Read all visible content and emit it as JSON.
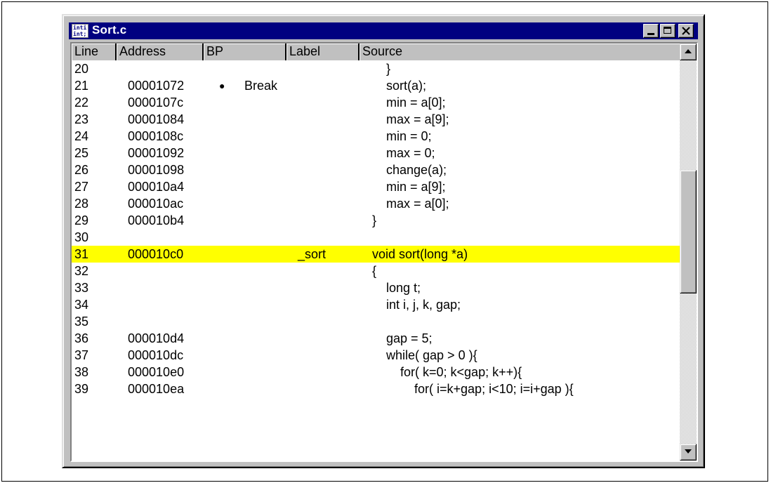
{
  "window": {
    "title": "Sort.c",
    "icon_text": [
      "inti",
      "int;"
    ],
    "controls": [
      "minimize",
      "maximize",
      "close"
    ]
  },
  "columns": {
    "line": "Line",
    "address": "Address",
    "bp": "BP",
    "label": "Label",
    "source": "Source"
  },
  "rows": [
    {
      "line": "20",
      "address": "",
      "bp_dot": "",
      "bp": "",
      "label": "",
      "source": "    }",
      "highlight": false
    },
    {
      "line": "21",
      "address": "00001072",
      "bp_dot": "●",
      "bp": "Break",
      "label": "",
      "source": "    sort(a);",
      "highlight": false
    },
    {
      "line": "22",
      "address": "0000107c",
      "bp_dot": "",
      "bp": "",
      "label": "",
      "source": "    min = a[0];",
      "highlight": false
    },
    {
      "line": "23",
      "address": "00001084",
      "bp_dot": "",
      "bp": "",
      "label": "",
      "source": "    max = a[9];",
      "highlight": false
    },
    {
      "line": "24",
      "address": "0000108c",
      "bp_dot": "",
      "bp": "",
      "label": "",
      "source": "    min = 0;",
      "highlight": false
    },
    {
      "line": "25",
      "address": "00001092",
      "bp_dot": "",
      "bp": "",
      "label": "",
      "source": "    max = 0;",
      "highlight": false
    },
    {
      "line": "26",
      "address": "00001098",
      "bp_dot": "",
      "bp": "",
      "label": "",
      "source": "    change(a);",
      "highlight": false
    },
    {
      "line": "27",
      "address": "000010a4",
      "bp_dot": "",
      "bp": "",
      "label": "",
      "source": "    min = a[9];",
      "highlight": false
    },
    {
      "line": "28",
      "address": "000010ac",
      "bp_dot": "",
      "bp": "",
      "label": "",
      "source": "    max = a[0];",
      "highlight": false
    },
    {
      "line": "29",
      "address": "000010b4",
      "bp_dot": "",
      "bp": "",
      "label": "",
      "source": "}",
      "highlight": false
    },
    {
      "line": "30",
      "address": "",
      "bp_dot": "",
      "bp": "",
      "label": "",
      "source": "",
      "highlight": false
    },
    {
      "line": "31",
      "address": "000010c0",
      "bp_dot": "",
      "bp": "",
      "label": "_sort",
      "source": "void sort(long *a)",
      "highlight": true
    },
    {
      "line": "32",
      "address": "",
      "bp_dot": "",
      "bp": "",
      "label": "",
      "source": "{",
      "highlight": false
    },
    {
      "line": "33",
      "address": "",
      "bp_dot": "",
      "bp": "",
      "label": "",
      "source": "    long t;",
      "highlight": false
    },
    {
      "line": "34",
      "address": "",
      "bp_dot": "",
      "bp": "",
      "label": "",
      "source": "    int i, j, k, gap;",
      "highlight": false
    },
    {
      "line": "35",
      "address": "",
      "bp_dot": "",
      "bp": "",
      "label": "",
      "source": "",
      "highlight": false
    },
    {
      "line": "36",
      "address": "000010d4",
      "bp_dot": "",
      "bp": "",
      "label": "",
      "source": "    gap = 5;",
      "highlight": false
    },
    {
      "line": "37",
      "address": "000010dc",
      "bp_dot": "",
      "bp": "",
      "label": "",
      "source": "    while( gap > 0 ){",
      "highlight": false
    },
    {
      "line": "38",
      "address": "000010e0",
      "bp_dot": "",
      "bp": "",
      "label": "",
      "source": "        for( k=0; k<gap; k++){",
      "highlight": false
    },
    {
      "line": "39",
      "address": "000010ea",
      "bp_dot": "",
      "bp": "",
      "label": "",
      "source": "            for( i=k+gap; i<10; i=i+gap ){",
      "highlight": false
    }
  ],
  "colors": {
    "titlebar": "#000080",
    "highlight": "#ffff00",
    "chrome": "#c0c0c0"
  },
  "icons": {
    "app": "source-file-icon",
    "breakpoint": "breakpoint-dot-icon",
    "scroll_up": "arrow-up-icon",
    "scroll_down": "arrow-down-icon"
  }
}
